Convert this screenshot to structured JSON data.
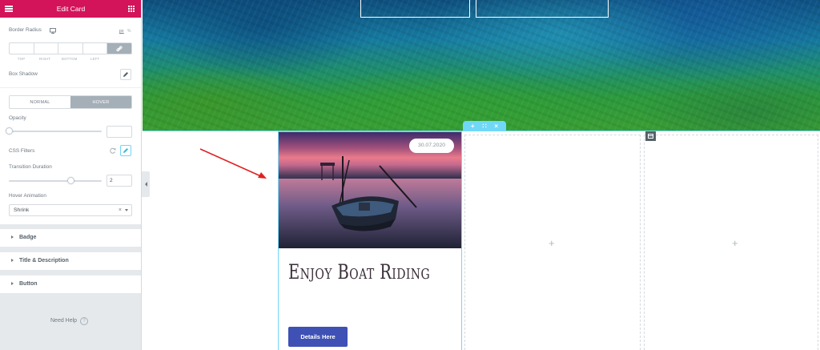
{
  "panel": {
    "title": "Edit Card",
    "border_radius_label": "Border Radius",
    "unit": "px",
    "unit_suffix": "%",
    "dim_labels": [
      "TOP",
      "RIGHT",
      "BOTTOM",
      "LEFT"
    ],
    "box_shadow_label": "Box Shadow",
    "tabs": {
      "normal": "NORMAL",
      "hover": "HOVER"
    },
    "opacity_label": "Opacity",
    "opacity_value": "",
    "css_filters_label": "CSS Filters",
    "transition_label": "Transition Duration",
    "transition_value": "2",
    "hover_animation_label": "Hover Animation",
    "hover_animation_value": "Shrink",
    "sections": [
      "Badge",
      "Title & Description",
      "Button"
    ],
    "need_help": "Need Help",
    "help_glyph": "?"
  },
  "preview": {
    "column_handle": [
      "+",
      "∷",
      "×"
    ],
    "add_glyph": "+"
  },
  "card": {
    "date": "30.07.2020",
    "title": "Enjoy Boat Riding",
    "button": "Details Here"
  },
  "colors": {
    "header": "#d3135a",
    "accent": "#71d7f7",
    "button": "#3f51b5",
    "arrow": "#e02020"
  }
}
